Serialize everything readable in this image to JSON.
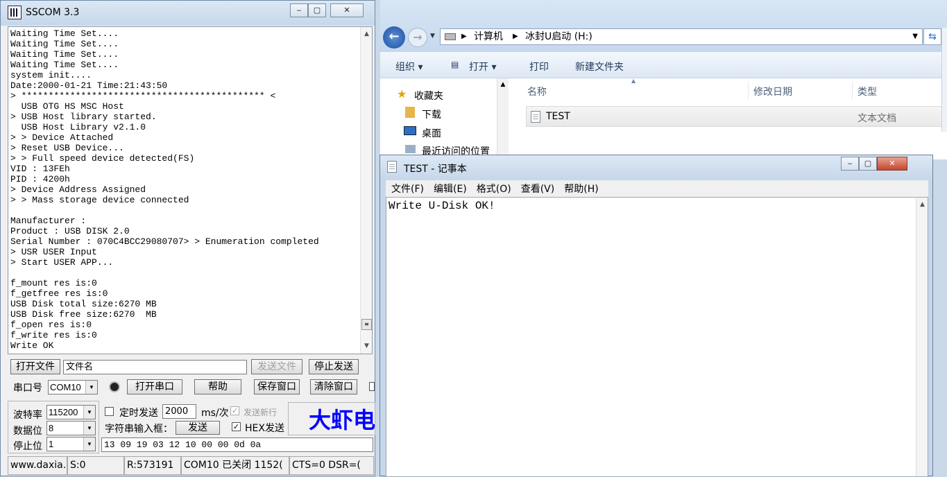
{
  "sscom": {
    "title": "SSCOM 3.3",
    "log_lines": [
      "Waiting Time Set....",
      "Waiting Time Set....",
      "Waiting Time Set....",
      "Waiting Time Set....",
      "system init....",
      "Date:2000-01-21 Time:21:43:50",
      "> ********************************************* <",
      "  USB OTG HS MSC Host",
      "> USB Host library started.",
      "  USB Host Library v2.1.0",
      "> > Device Attached",
      "> Reset USB Device...",
      "> > Full speed device detected(FS)",
      "VID : 13FEh",
      "PID : 4200h",
      "> Device Address Assigned",
      "> > Mass storage device connected",
      "",
      "Manufacturer :",
      "Product : USB DISK 2.0",
      "Serial Number : 070C4BCC29080707> > Enumeration completed",
      "> USR USER Input",
      "> Start USER APP...",
      "",
      "f_mount res is:0",
      "f_getfree res is:0",
      "USB Disk total size:6270 MB",
      "USB Disk free size:6270  MB",
      "f_open res is:0",
      "f_write res is:0",
      "Write OK"
    ],
    "open_file_button": "打开文件",
    "filename_value": "文件名",
    "send_file_button": "发送文件",
    "stop_send_button": "停止发送",
    "port_label": "串口号",
    "port_value": "COM10",
    "open_port_button": "打开串口",
    "help_button": "帮助",
    "save_window_button": "保存窗口",
    "clear_window_button": "清除窗口",
    "baud_label": "波特率",
    "baud_value": "115200",
    "databits_label": "数据位",
    "databits_value": "8",
    "stopbits_label": "停止位",
    "stopbits_value": "1",
    "timed_send_label": "定时发送",
    "interval_value": "2000",
    "interval_unit": "ms/次",
    "send_newline_label": "发送新行",
    "string_input_label": "字符串输入框：",
    "send_button": "发送",
    "hex_send_label": "HEX发送",
    "hex_input_value": "13 09 19 03 12 10 00 00 0d 0a",
    "brand_text": "大虾电",
    "status": {
      "website": "www.daxia.",
      "sent": "S:0",
      "received": "R:573191",
      "port_status": "COM10 已关闭  1152(",
      "signals": "CTS=0 DSR=("
    }
  },
  "explorer": {
    "breadcrumb": [
      "计算机",
      "冰封U启动 (H:)"
    ],
    "toolbar": [
      "组织 ▾",
      "打开 ▾",
      "打印",
      "新建文件夹"
    ],
    "nav": [
      "收藏夹",
      "下载",
      "桌面",
      "最近访问的位置"
    ],
    "columns": [
      "名称",
      "修改日期",
      "类型"
    ],
    "file": {
      "name": "TEST",
      "type": "文本文档"
    }
  },
  "notepad": {
    "title": "TEST - 记事本",
    "menus": [
      "文件(F)",
      "编辑(E)",
      "格式(O)",
      "查看(V)",
      "帮助(H)"
    ],
    "content": "Write U-Disk OK!"
  },
  "colors": {
    "brand": "#0000ff",
    "titlebar": "#c6d7ea",
    "close": "#c6452f"
  }
}
